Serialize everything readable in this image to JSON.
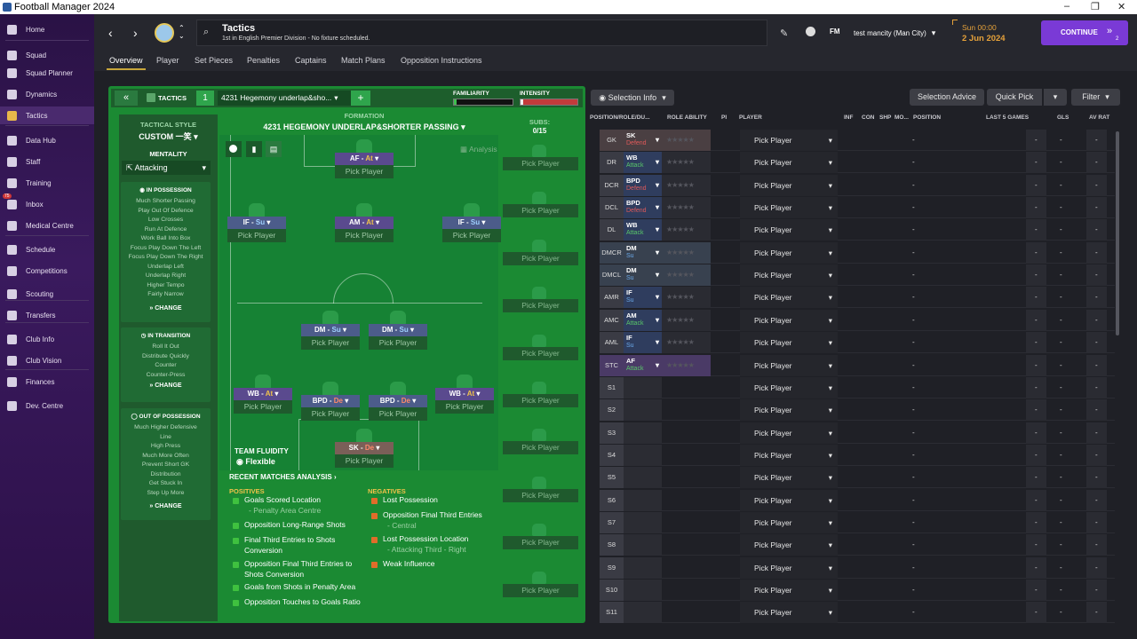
{
  "window": {
    "title": "Football Manager 2024",
    "controls": [
      "–",
      "❐",
      "✕"
    ]
  },
  "sidebar": {
    "items": [
      {
        "label": "Home",
        "icon": "home-icon"
      },
      {
        "label": "Squad",
        "icon": "shirt-icon"
      },
      {
        "label": "Squad Planner",
        "icon": "planner-icon"
      },
      {
        "label": "Dynamics",
        "icon": "dynamics-icon"
      },
      {
        "label": "Tactics",
        "icon": "tactics-icon",
        "active": true
      },
      {
        "label": "Data Hub",
        "icon": "data-hub-icon"
      },
      {
        "label": "Staff",
        "icon": "staff-icon"
      },
      {
        "label": "Training",
        "icon": "training-icon"
      },
      {
        "label": "Inbox",
        "icon": "inbox-icon",
        "badge": "75"
      },
      {
        "label": "Medical Centre",
        "icon": "medical-icon"
      },
      {
        "label": "Schedule",
        "icon": "schedule-icon"
      },
      {
        "label": "Competitions",
        "icon": "trophy-icon"
      },
      {
        "label": "Scouting",
        "icon": "scouting-icon"
      },
      {
        "label": "Transfers",
        "icon": "transfers-icon"
      },
      {
        "label": "Club Info",
        "icon": "shield-icon"
      },
      {
        "label": "Club Vision",
        "icon": "vision-icon"
      },
      {
        "label": "Finances",
        "icon": "finances-icon"
      },
      {
        "label": "Dev. Centre",
        "icon": "dev-centre-icon"
      }
    ]
  },
  "header": {
    "title": "Tactics",
    "subtitle": "1st in English Premier Division - No fixture scheduled.",
    "manager": "test mancity (Man City)",
    "fm_label": "FM",
    "time": "Sun 00:00",
    "date": "2 Jun 2024",
    "continue_label": "CONTINUE",
    "continue_count": "2"
  },
  "tabs": [
    "Overview",
    "Player",
    "Set Pieces",
    "Penalties",
    "Captains",
    "Match Plans",
    "Opposition Instructions"
  ],
  "tactic_bar": {
    "tactics_label": "TACTICS",
    "slot_number": "1",
    "tactic_name": "4231 Hegemony underlap&sho...",
    "add": "+",
    "familiarity_label": "FAMILIARITY",
    "intensity_label": "INTENSITY",
    "familiarity": 0.05,
    "intensity": 0.05
  },
  "tactical_style": {
    "label": "TACTICAL STYLE",
    "value": "CUSTOM 一笑",
    "mentality_label": "MENTALITY",
    "mentality": "Attacking",
    "change": "CHANGE",
    "in_possession": {
      "title": "IN POSSESSION",
      "lines": [
        "Much Shorter Passing",
        "Play Out Of Defence",
        "Low Crosses",
        "Run At Defence",
        "Work Ball Into Box",
        "Focus Play Down The Left",
        "Focus Play Down The Right",
        "Underlap Left",
        "Underlap Right",
        "Higher Tempo",
        "Fairly Narrow"
      ]
    },
    "in_transition": {
      "title": "IN TRANSITION",
      "lines": [
        "Roll It Out",
        "Distribute Quickly",
        "Counter",
        "Counter-Press"
      ]
    },
    "out_of_possession": {
      "title": "OUT OF POSSESSION",
      "lines": [
        "Much Higher Defensive",
        "Line",
        "High Press",
        "Much More Often",
        "Prevent Short GK",
        "Distribution",
        "Get Stuck In",
        "Step Up More"
      ]
    }
  },
  "formation": {
    "label": "FORMATION",
    "name": "4231 HEGEMONY UNDERLAP&SHORTER PASSING",
    "subs_label": "SUBS:",
    "subs_count": "0/15",
    "analysis": "Analysis",
    "pick_player": "Pick Player",
    "team_fluidity_label": "TEAM FLUIDITY",
    "team_fluidity": "Flexible"
  },
  "pitch_slots": [
    {
      "role": "AF",
      "duty": "At"
    },
    {
      "role": "IF",
      "duty": "Su"
    },
    {
      "role": "AM",
      "duty": "At"
    },
    {
      "role": "IF",
      "duty": "Su"
    },
    {
      "role": "DM",
      "duty": "Su"
    },
    {
      "role": "DM",
      "duty": "Su"
    },
    {
      "role": "WB",
      "duty": "At"
    },
    {
      "role": "BPD",
      "duty": "De"
    },
    {
      "role": "BPD",
      "duty": "De"
    },
    {
      "role": "WB",
      "duty": "At"
    },
    {
      "role": "SK",
      "duty": "De"
    }
  ],
  "analysis": {
    "title": "RECENT MATCHES ANALYSIS",
    "positives_label": "POSITIVES",
    "negatives_label": "NEGATIVES",
    "positives": [
      {
        "text": "Goals Scored Location",
        "sub": "- Penalty Area Centre"
      },
      {
        "text": "Opposition Long-Range Shots",
        "sub": ""
      },
      {
        "text": "Final Third Entries to Shots Conversion",
        "sub": ""
      },
      {
        "text": "Opposition Final Third Entries to Shots Conversion",
        "sub": ""
      },
      {
        "text": "Goals from Shots in Penalty Area",
        "sub": ""
      },
      {
        "text": "Opposition Touches to Goals Ratio",
        "sub": ""
      }
    ],
    "negatives": [
      {
        "text": "Lost Possession",
        "sub": ""
      },
      {
        "text": "Opposition Final Third Entries",
        "sub": "- Central"
      },
      {
        "text": "Lost Possession Location",
        "sub": "- Attacking Third - Right"
      },
      {
        "text": "Weak Influence",
        "sub": ""
      }
    ]
  },
  "selection": {
    "info": "Selection Info",
    "advice": "Selection Advice",
    "quick_pick": "Quick Pick",
    "filter": "Filter",
    "columns": [
      "POSITION/ROLE/DU...",
      "ROLE ABILITY",
      "PI",
      "PLAYER",
      "INF",
      "CON",
      "SHP",
      "MO...",
      "POSITION",
      "LAST 5 GAMES",
      "GLS",
      "AV RAT"
    ],
    "rows": [
      {
        "pos": "GK",
        "role": "SK",
        "duty": "Defend"
      },
      {
        "pos": "DR",
        "role": "WB",
        "duty": "Attack"
      },
      {
        "pos": "DCR",
        "role": "BPD",
        "duty": "Defend"
      },
      {
        "pos": "DCL",
        "role": "BPD",
        "duty": "Defend"
      },
      {
        "pos": "DL",
        "role": "WB",
        "duty": "Attack"
      },
      {
        "pos": "DMCR",
        "role": "DM",
        "duty": "Su"
      },
      {
        "pos": "DMCL",
        "role": "DM",
        "duty": "Su"
      },
      {
        "pos": "AMR",
        "role": "IF",
        "duty": "Su"
      },
      {
        "pos": "AMC",
        "role": "AM",
        "duty": "Attack"
      },
      {
        "pos": "AML",
        "role": "IF",
        "duty": "Su"
      },
      {
        "pos": "STC",
        "role": "AF",
        "duty": "Attack"
      },
      {
        "pos": "S1",
        "role": "",
        "duty": ""
      },
      {
        "pos": "S2",
        "role": "",
        "duty": ""
      },
      {
        "pos": "S3",
        "role": "",
        "duty": ""
      },
      {
        "pos": "S4",
        "role": "",
        "duty": ""
      },
      {
        "pos": "S5",
        "role": "",
        "duty": ""
      },
      {
        "pos": "S6",
        "role": "",
        "duty": ""
      },
      {
        "pos": "S7",
        "role": "",
        "duty": ""
      },
      {
        "pos": "S8",
        "role": "",
        "duty": ""
      },
      {
        "pos": "S9",
        "role": "",
        "duty": ""
      },
      {
        "pos": "S10",
        "role": "",
        "duty": ""
      },
      {
        "pos": "S11",
        "role": "",
        "duty": ""
      }
    ],
    "pick_player": "Pick Player",
    "dash": "-",
    "stars": "★★★★★"
  }
}
